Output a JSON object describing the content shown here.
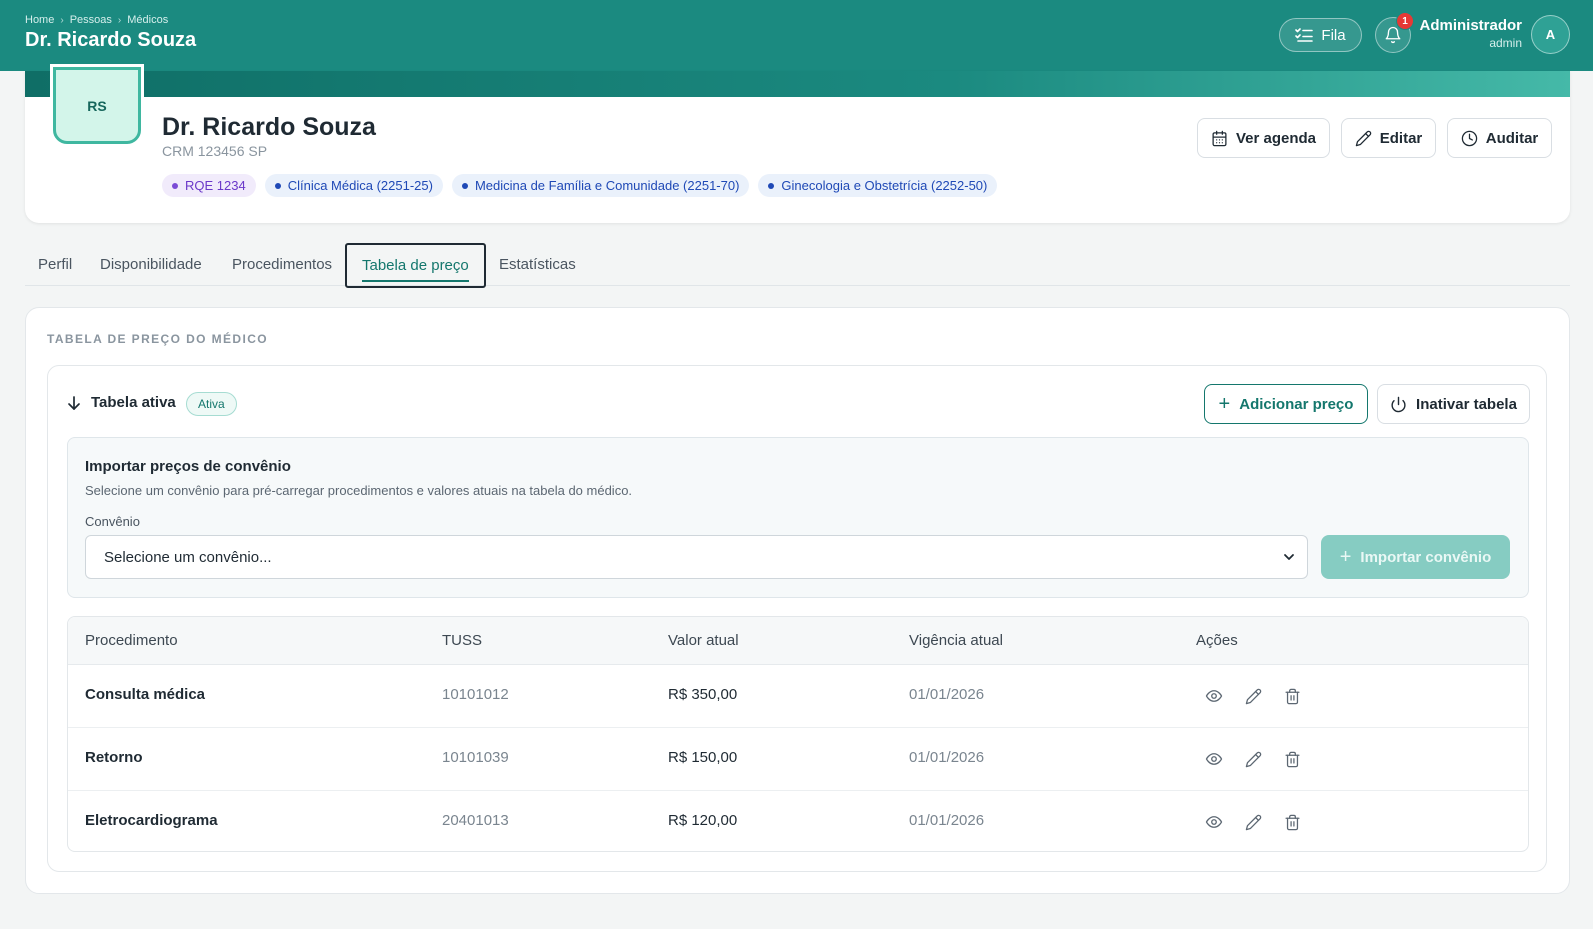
{
  "header": {
    "breadcrumb": [
      "Home",
      "Pessoas",
      "Médicos"
    ],
    "title": "Dr. Ricardo Souza",
    "fila_label": "Fila",
    "notifications_count": "1",
    "user_name": "Administrador",
    "user_role": "admin",
    "avatar_initial": "A"
  },
  "profile": {
    "initials": "RS",
    "name": "Dr. Ricardo Souza",
    "crm": "CRM 123456 SP",
    "chips": [
      {
        "label": "RQE 1234",
        "kind": "rqe"
      },
      {
        "label": "Clínica Médica (2251-25)",
        "kind": "spec"
      },
      {
        "label": "Medicina de Família e Comunidade (2251-70)",
        "kind": "spec"
      },
      {
        "label": "Ginecologia e Obstetrícia (2252-50)",
        "kind": "spec"
      }
    ],
    "actions": {
      "agenda": "Ver agenda",
      "edit": "Editar",
      "audit": "Auditar"
    }
  },
  "tabs": [
    "Perfil",
    "Disponibilidade",
    "Procedimentos",
    "Tabela de preço",
    "Estatísticas"
  ],
  "active_tab": "Tabela de preço",
  "section": {
    "title": "TABELA DE PREÇO DO MÉDICO",
    "table_toggle": "Tabela ativa",
    "status_badge": "Ativa",
    "add_price": "Adicionar preço",
    "deactivate": "Inativar tabela"
  },
  "import": {
    "title": "Importar preços de convênio",
    "description": "Selecione um convênio para pré-carregar procedimentos e valores atuais na tabela do médico.",
    "label": "Convênio",
    "placeholder": "Selecione um convênio...",
    "button": "Importar convênio"
  },
  "table": {
    "columns": [
      "Procedimento",
      "TUSS",
      "Valor atual",
      "Vigência atual",
      "Ações"
    ],
    "rows": [
      {
        "procedimento": "Consulta médica",
        "tuss": "10101012",
        "valor": "R$ 350,00",
        "vigencia": "01/01/2026"
      },
      {
        "procedimento": "Retorno",
        "tuss": "10101039",
        "valor": "R$ 150,00",
        "vigencia": "01/01/2026"
      },
      {
        "procedimento": "Eletrocardiograma",
        "tuss": "20401013",
        "valor": "R$ 120,00",
        "vigencia": "01/01/2026"
      }
    ]
  },
  "colors": {
    "brand": "#1b8a80",
    "accent": "#14776d",
    "notification": "#e53935"
  }
}
